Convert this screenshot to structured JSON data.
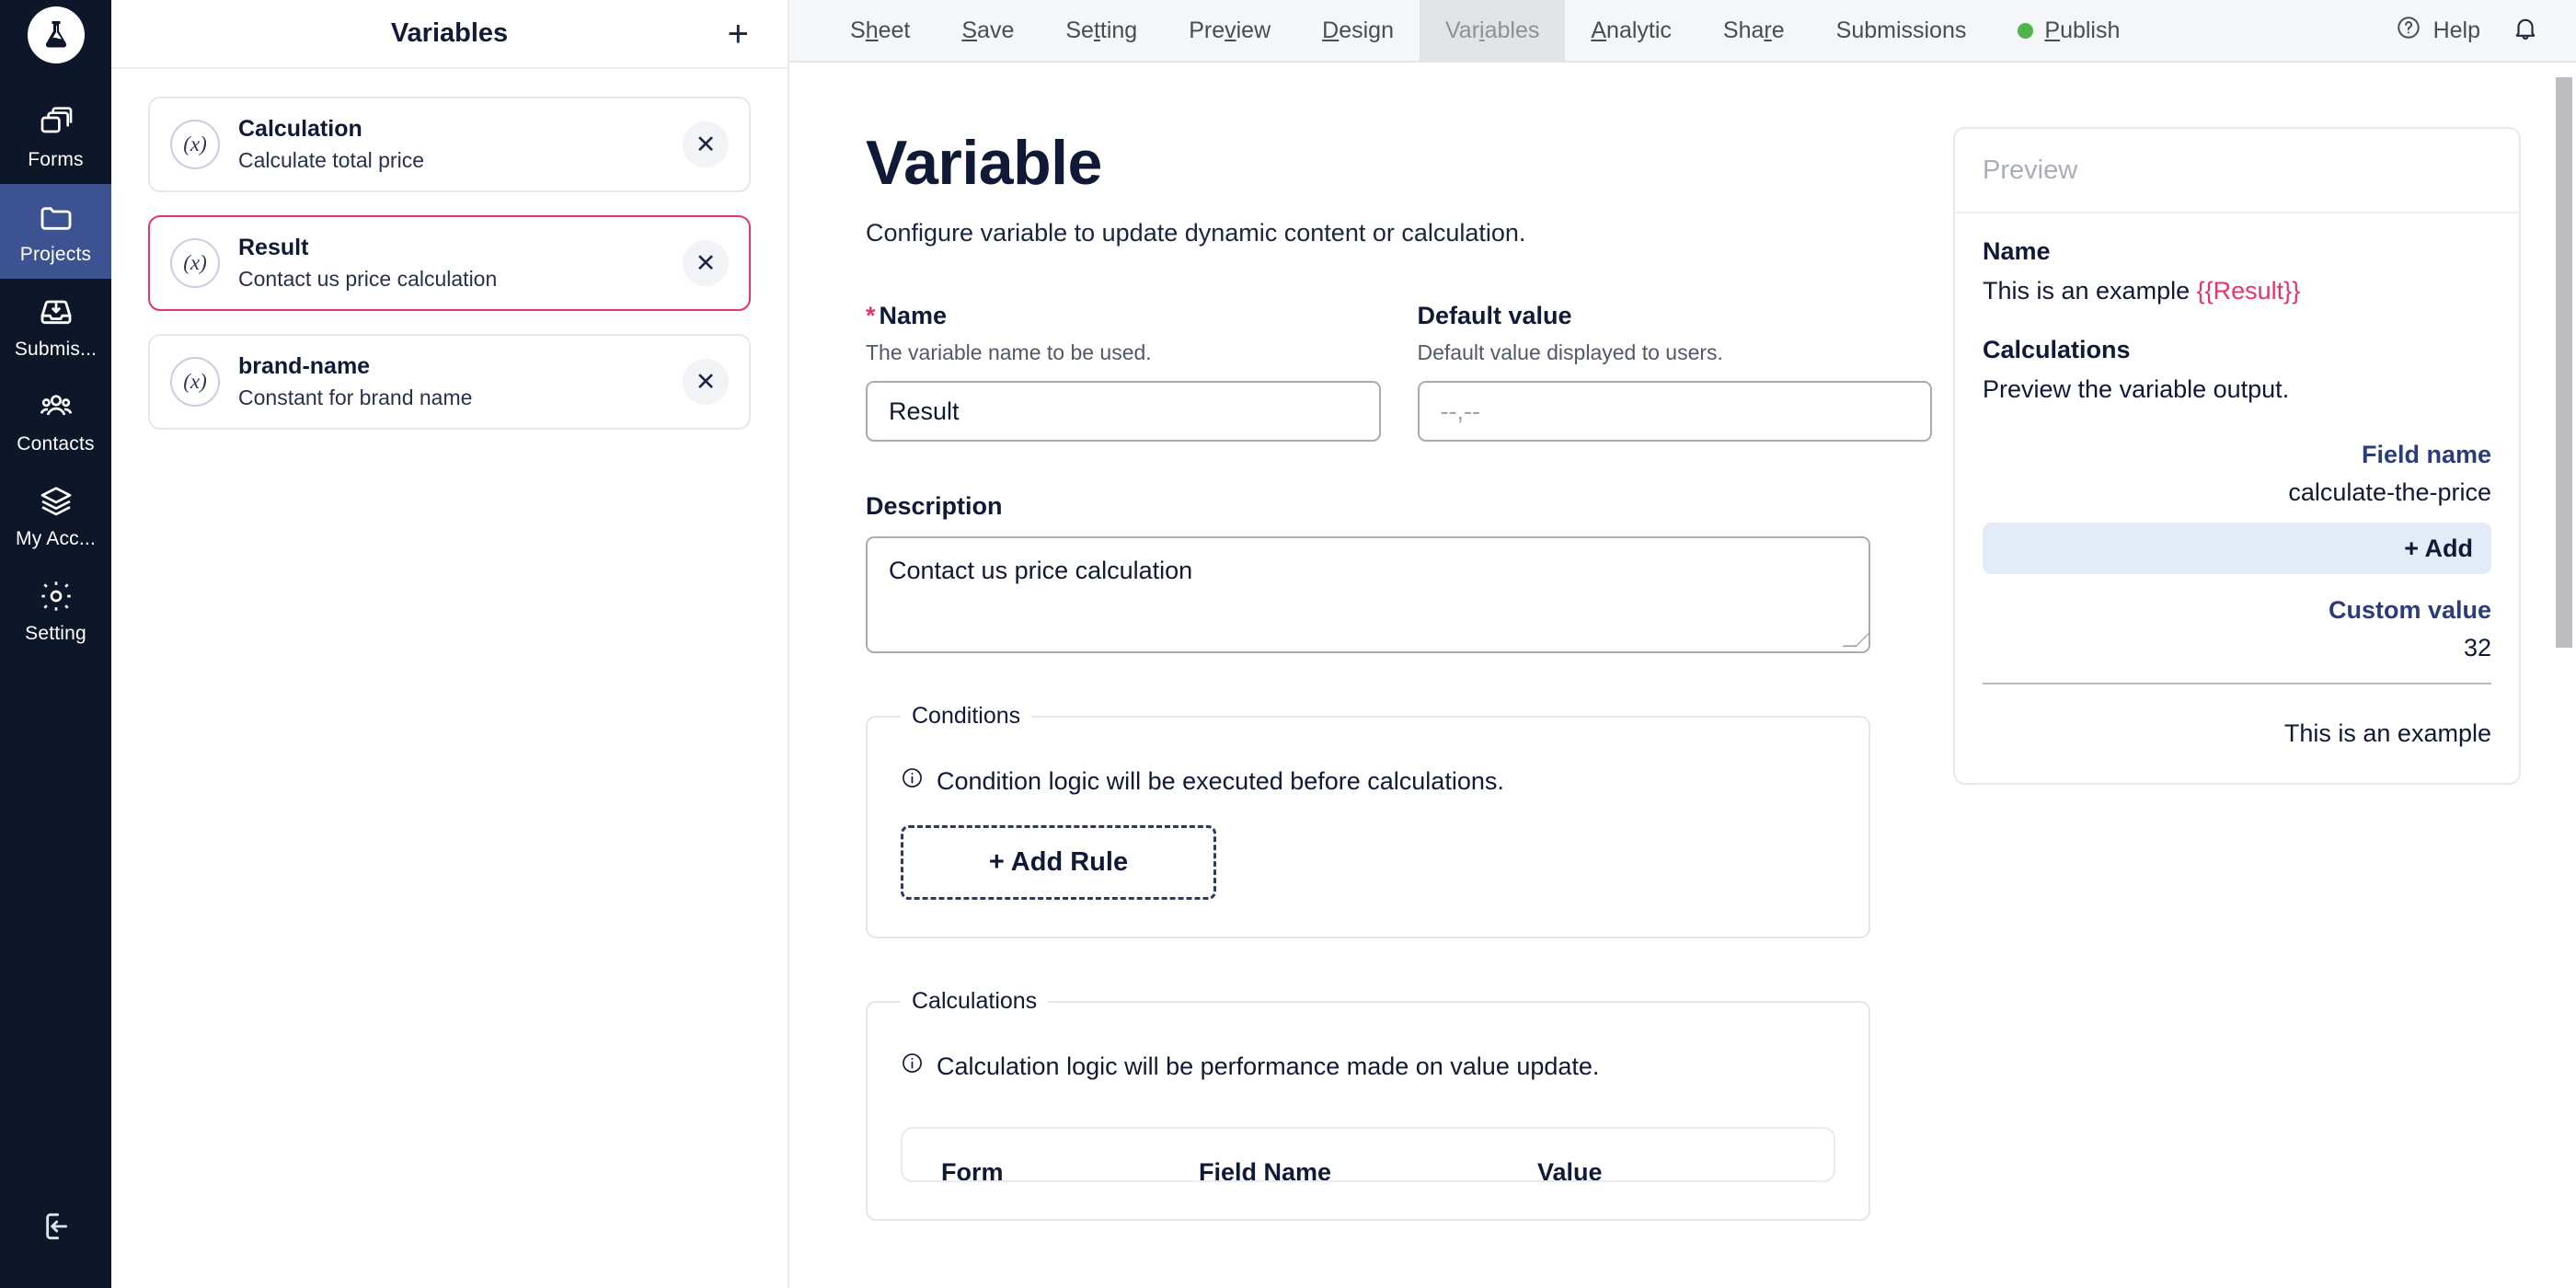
{
  "brand": {
    "logo_icon": "flask-icon"
  },
  "rail": {
    "items": [
      {
        "label": "Forms",
        "icon": "forms-copy-icon",
        "active": false
      },
      {
        "label": "Projects",
        "icon": "folder-icon",
        "active": true
      },
      {
        "label": "Submis...",
        "icon": "inbox-download-icon",
        "active": false
      },
      {
        "label": "Contacts",
        "icon": "people-icon",
        "active": false
      },
      {
        "label": "My Acc...",
        "icon": "layers-icon",
        "active": false
      },
      {
        "label": "Setting",
        "icon": "gear-icon",
        "active": false
      }
    ],
    "logout_icon": "logout-icon"
  },
  "topbar": {
    "menu": [
      {
        "label": "Sheet",
        "mnemonic": "h",
        "active": false
      },
      {
        "label": "Save",
        "mnemonic": "S",
        "active": false
      },
      {
        "label": "Setting",
        "mnemonic": "t",
        "active": false
      },
      {
        "label": "Preview",
        "mnemonic": "v",
        "active": false
      },
      {
        "label": "Design",
        "mnemonic": "D",
        "active": false
      },
      {
        "label": "Variables",
        "mnemonic": "i",
        "active": true
      },
      {
        "label": "Analytic",
        "mnemonic": "A",
        "active": false
      },
      {
        "label": "Share",
        "mnemonic": "r",
        "active": false
      },
      {
        "label": "Submissions",
        "mnemonic": "",
        "active": false
      },
      {
        "label": "Publish",
        "mnemonic": "P",
        "active": false,
        "status_dot": "#51b44b"
      }
    ],
    "help_label": "Help",
    "help_icon": "question-circle-icon",
    "notifications_icon": "bell-icon"
  },
  "varpanel": {
    "title": "Variables",
    "add_icon": "plus-icon",
    "items": [
      {
        "icon": "variable-fx-icon",
        "glyph": "(x)",
        "name": "Calculation",
        "description": "Calculate total price",
        "selected": false,
        "close_icon": "close-icon"
      },
      {
        "icon": "variable-fx-icon",
        "glyph": "(x)",
        "name": "Result",
        "description": "Contact us price calculation",
        "selected": true,
        "close_icon": "close-icon"
      },
      {
        "icon": "variable-fx-icon",
        "glyph": "(x)",
        "name": "brand-name",
        "description": "Constant for brand name",
        "selected": false,
        "close_icon": "close-icon"
      }
    ]
  },
  "main": {
    "title": "Variable",
    "subtitle": "Configure variable to update dynamic content or calculation.",
    "name_field": {
      "required_mark": "*",
      "label": "Name",
      "hint": "The variable name to be used.",
      "value": "Result"
    },
    "default_field": {
      "label": "Default value",
      "hint": "Default value displayed to users.",
      "value": "",
      "placeholder": "--,--"
    },
    "description_field": {
      "label": "Description",
      "value": "Contact us price calculation"
    },
    "conditions": {
      "legend": "Conditions",
      "info_icon": "info-circle-icon",
      "note": "Condition logic will be executed before calculations.",
      "add_rule_label": "+ Add Rule"
    },
    "calculations": {
      "legend": "Calculations",
      "info_icon": "info-circle-icon",
      "note": "Calculation logic will be performance made on value update.",
      "table_headers": {
        "form": "Form",
        "field_name": "Field Name",
        "value": "Value"
      }
    }
  },
  "preview": {
    "header": "Preview",
    "name_heading": "Name",
    "name_text_prefix": "This is an example ",
    "name_template": "{{Result}}",
    "calc_heading": "Calculations",
    "calc_text": "Preview the variable output.",
    "field_name_label": "Field name",
    "field_name_value": "calculate-the-price",
    "add_label": "+ Add",
    "custom_value_label": "Custom value",
    "custom_value": "32",
    "footer_text": "This is an example"
  },
  "colors": {
    "rail_bg": "#0d1729",
    "rail_active": "#3c5291",
    "accent_pink": "#e8336d",
    "accent_navy": "#2b3c7a",
    "status_green": "#51b44b"
  },
  "scrollbar": {
    "name": "vertical-scrollbar"
  }
}
